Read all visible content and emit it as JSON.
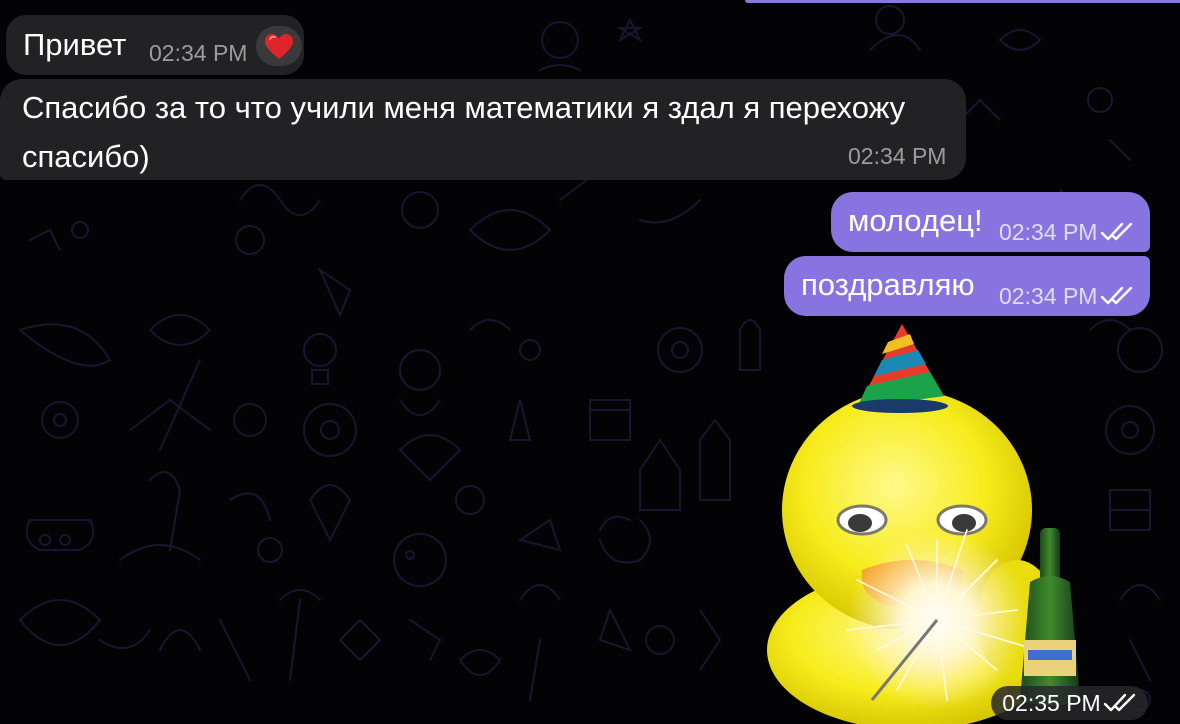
{
  "messages": [
    {
      "direction": "incoming",
      "text": "Привет",
      "time": "02:34 PM",
      "reaction": "heart"
    },
    {
      "direction": "incoming",
      "text": "Спасибо за то что учили меня математики я здал я перехожу спасибо)",
      "time": "02:34 PM"
    },
    {
      "direction": "outgoing",
      "text": "молодец!",
      "time": "02:34 PM",
      "status": "read"
    },
    {
      "direction": "outgoing",
      "text": "поздравляю",
      "time": "02:34 PM",
      "status": "read"
    },
    {
      "direction": "outgoing",
      "type": "sticker",
      "sticker": "yellow-duck-party-hat-sparkler",
      "time": "02:35 PM",
      "status": "read"
    }
  ],
  "colors": {
    "background": "#030305",
    "incoming_bubble": "#222224",
    "outgoing_bubble": "#8774e1",
    "reaction_heart": "#e0242b",
    "wallpaper_doodle": "#2b2552"
  }
}
